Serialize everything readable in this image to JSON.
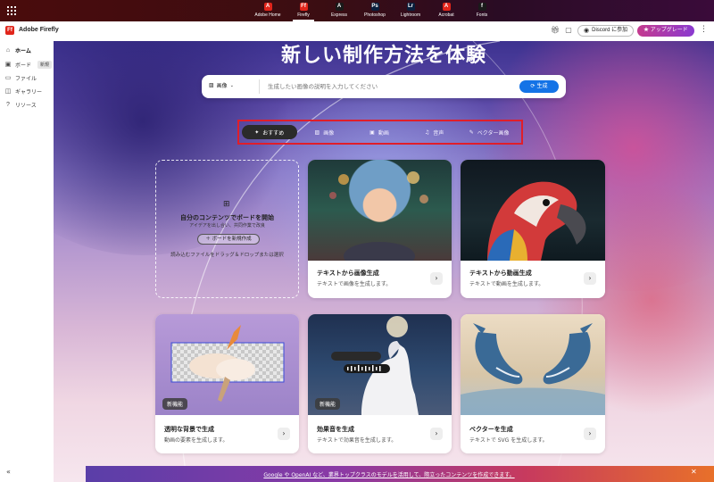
{
  "appbar": {
    "apps": [
      {
        "label": "Adobe Home",
        "icon": "adobe-icon",
        "color": "#e1251b",
        "glyph": "A",
        "active": false
      },
      {
        "label": "Firefly",
        "icon": "firefly-icon",
        "color": "#e1251b",
        "glyph": "Ff",
        "active": true
      },
      {
        "label": "Express",
        "icon": "express-icon",
        "color": "#1a1a1a",
        "glyph": "A",
        "active": false
      },
      {
        "label": "Photoshop",
        "icon": "photoshop-icon",
        "color": "#0a1f3d",
        "glyph": "Ps",
        "active": false
      },
      {
        "label": "Lightroom",
        "icon": "lightroom-icon",
        "color": "#0a1f3d",
        "glyph": "Lr",
        "active": false
      },
      {
        "label": "Acrobat",
        "icon": "acrobat-icon",
        "color": "#e1251b",
        "glyph": "A",
        "active": false
      },
      {
        "label": "Fonts",
        "icon": "fonts-icon",
        "color": "#1a1a1a",
        "glyph": "f",
        "active": false
      }
    ]
  },
  "topbar": {
    "logo": "Ff",
    "app_name": "Adobe Firefly",
    "discord": "Discord に参加",
    "upgrade": "アップグレード"
  },
  "sidebar": {
    "items": [
      {
        "label": "ホーム",
        "icon": "home-icon",
        "active": true
      },
      {
        "label": "ボード",
        "icon": "board-icon",
        "badge": "新規"
      },
      {
        "label": "ファイル",
        "icon": "folder-icon"
      },
      {
        "label": "ギャラリー",
        "icon": "gallery-icon"
      },
      {
        "label": "リソース",
        "icon": "resources-icon"
      }
    ]
  },
  "hero": {
    "title": "新しい制作方法を体験"
  },
  "prompt": {
    "type_label": "画像",
    "placeholder": "生成したい画像の説明を入力してください",
    "generate": "生成"
  },
  "tabs": [
    {
      "label": "おすすめ",
      "icon": "sparkle-icon",
      "active": true
    },
    {
      "label": "画像",
      "icon": "image-icon"
    },
    {
      "label": "動画",
      "icon": "video-icon"
    },
    {
      "label": "音声",
      "icon": "audio-icon"
    },
    {
      "label": "ベクター画像",
      "icon": "vector-icon"
    }
  ],
  "board_card": {
    "title": "自分のコンテンツでボードを開始",
    "subtitle": "アイデアを出し合い、共同作業で改良",
    "button": "ボードを新規作成",
    "hint": "読み込むファイルをドラッグ＆ドロップまたは選択"
  },
  "cards": [
    {
      "title": "テキストから画像生成",
      "desc": "テキストで画像を生成します。"
    },
    {
      "title": "テキストから動画生成",
      "desc": "テキストで動画を生成します。"
    },
    {
      "title": "透明な背景で生成",
      "desc": "動画の要素を生成します。",
      "tag": "新機能"
    },
    {
      "title": "効果音を生成",
      "desc": "テキストで効果音を生成します。",
      "tag": "新機能"
    },
    {
      "title": "ベクターを生成",
      "desc": "テキストで SVG を生成します。"
    }
  ],
  "banner": {
    "text": "Google や OpenAI など、業界トップクラスのモデルを活用して、際立ったコンテンツを作成できます。"
  }
}
